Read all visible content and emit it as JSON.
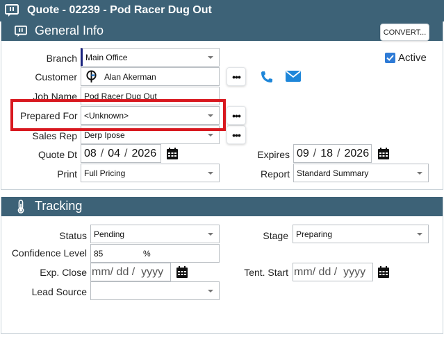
{
  "window": {
    "title": "Quote - 02239 - Pod Racer Dug Out",
    "title_icon": "message-box-icon"
  },
  "general": {
    "heading": "General Info",
    "heading_icon": "message-box-icon",
    "convert_label": "CONVERT...",
    "active_label": "Active",
    "active_checked": true,
    "branch_label": "Branch",
    "branch_value": "Main Office",
    "customer_label": "Customer",
    "customer_value": "Alan Akerman",
    "customer_icon": "customer-logo-icon",
    "job_name_label": "Job Name",
    "job_name_value": "Pod Racer Dug Out",
    "prepared_for_label": "Prepared For",
    "prepared_for_value": "<Unknown>",
    "sales_rep_label": "Sales Rep",
    "sales_rep_value": "Derp Ipose",
    "quote_dt_label": "Quote Dt",
    "quote_dt_month": "08",
    "quote_dt_day": "04",
    "quote_dt_year": "2026",
    "expires_label": "Expires",
    "expires_month": "09",
    "expires_day": "18",
    "expires_year": "2026",
    "print_label": "Print",
    "print_value": "Full Pricing",
    "report_label": "Report",
    "report_value": "Standard Summary",
    "ellipsis": "•••",
    "date_sep": "/"
  },
  "tracking": {
    "heading": "Tracking",
    "heading_icon": "thermometer-icon",
    "status_label": "Status",
    "status_value": "Pending",
    "stage_label": "Stage",
    "stage_value": "Preparing",
    "confidence_label": "Confidence Level",
    "confidence_value": "85",
    "confidence_unit": "%",
    "exp_close_label": "Exp. Close",
    "exp_close_placeholder": "mm/ dd /  yyyy",
    "tent_start_label": "Tent. Start",
    "tent_start_placeholder": "mm/ dd /  yyyy",
    "lead_source_label": "Lead Source",
    "lead_source_value": ""
  },
  "colors": {
    "header_bg": "#3d6277",
    "accent_blue": "#2e7bd6",
    "highlight_red": "#d8181f",
    "branch_accent": "#1a237e"
  }
}
